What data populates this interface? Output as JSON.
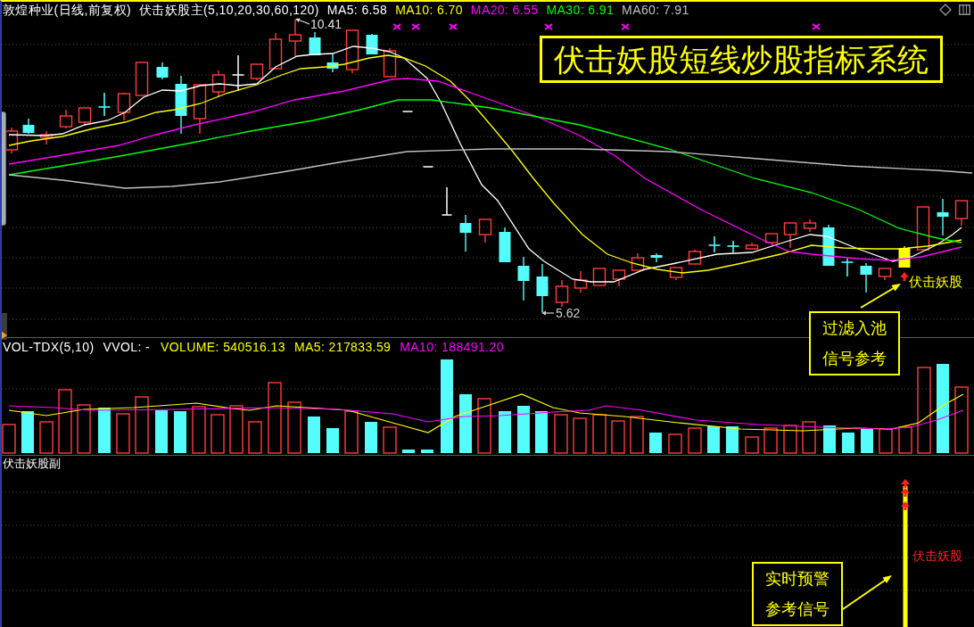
{
  "title_bar": {
    "stock": "敦煌种业(日线,前复权)",
    "indicator": "伏击妖股主(5,10,20,30,60,120)",
    "readings": [
      {
        "label": "MA5: 6.58",
        "color": "#ffffff"
      },
      {
        "label": "MA10: 6.70",
        "color": "#ffff00"
      },
      {
        "label": "MA20: 6.55",
        "color": "#ff00ff"
      },
      {
        "label": "MA30: 6.91",
        "color": "#00ff00"
      },
      {
        "label": "MA60: 7.91",
        "color": "#c0c0c0"
      }
    ]
  },
  "banner": {
    "text": "伏击妖股短线炒股指标系统"
  },
  "price_chart": {
    "high_label": "10.41",
    "low_label": "5.62",
    "signal_label": "伏击妖股",
    "callout": [
      "过滤入池",
      "信号参考"
    ]
  },
  "volume_panel": {
    "indicator": "VOL-TDX(5,10)",
    "vvol": "VVOL: -",
    "readings": [
      {
        "label": "VOLUME: 540516.13",
        "color": "#ffff00"
      },
      {
        "label": "MA5: 217833.59",
        "color": "#ffff00"
      },
      {
        "label": "MA10: 188491.20",
        "color": "#ff00ff"
      }
    ]
  },
  "sub_panel": {
    "title": "伏击妖股副",
    "signal_label": "伏击妖股",
    "callout": [
      "实时预警",
      "参考信号"
    ]
  }
}
